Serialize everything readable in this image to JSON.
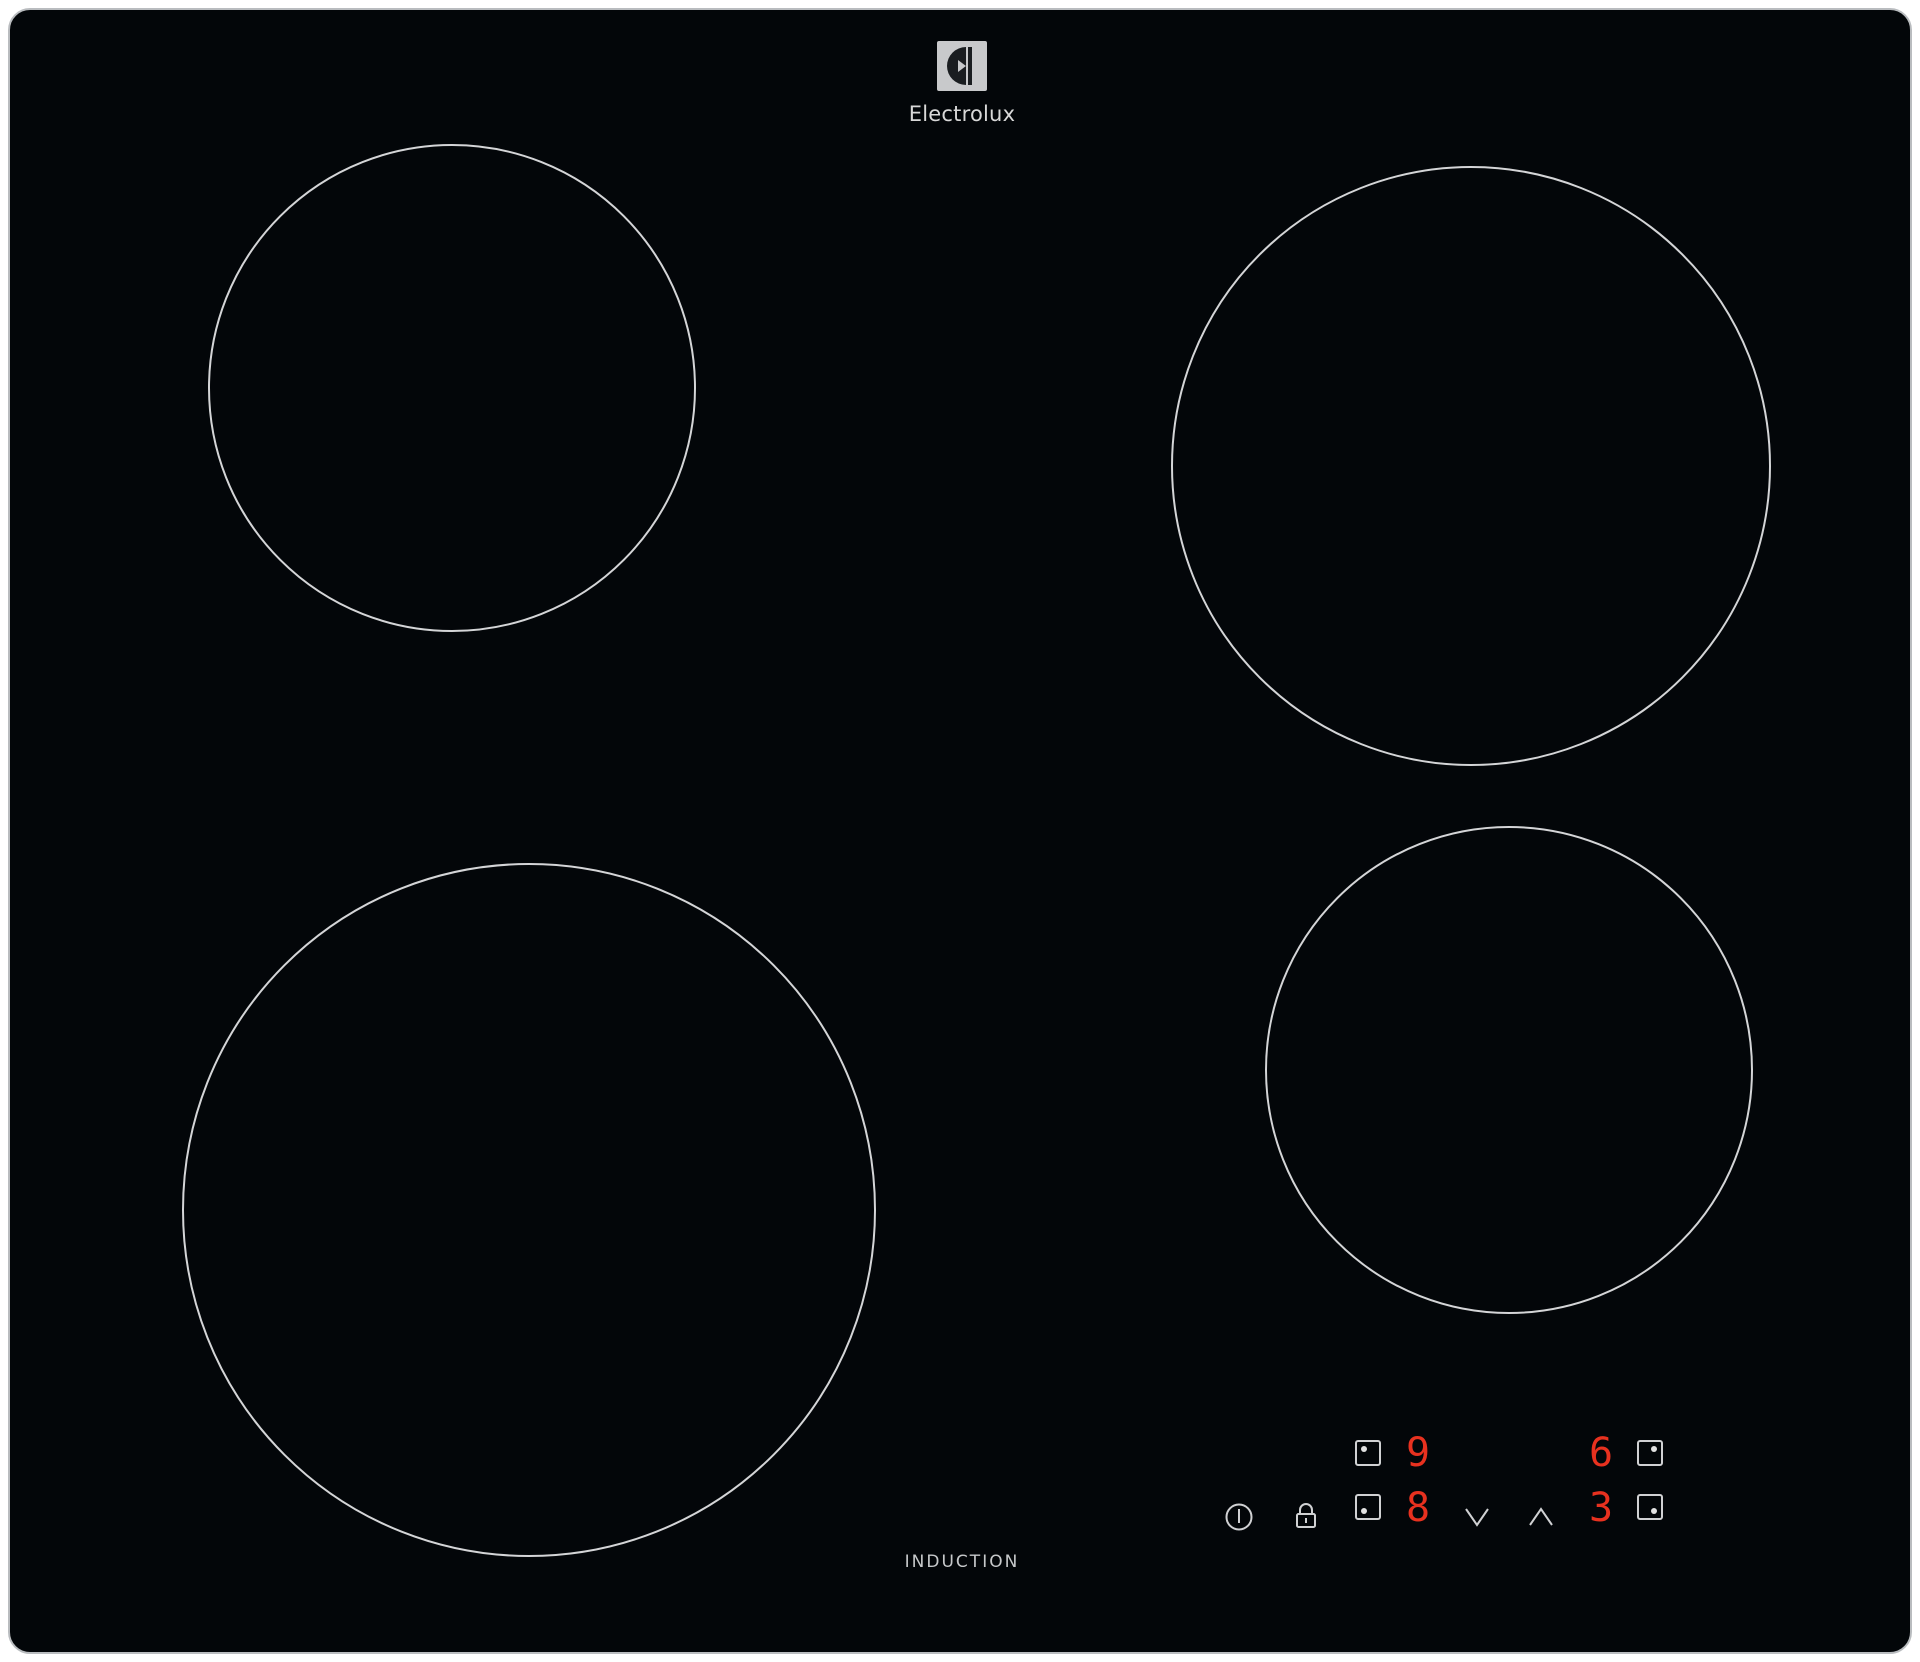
{
  "brand": {
    "name": "Electrolux",
    "logo_icon": "electrolux-logo-icon"
  },
  "cooktop": {
    "label": "INDUCTION",
    "surface_color": "#030609",
    "zone_outline_color": "#d4d5d7",
    "cooking_zones": 4
  },
  "controls": {
    "display_color": "#e8311f",
    "displays": {
      "rear_left": "9",
      "front_left": "8",
      "rear_right": "6",
      "front_right": "3"
    },
    "icons": {
      "power": "power-icon",
      "lock": "lock-icon",
      "minus": "chevron-down-icon",
      "plus": "chevron-up-icon"
    }
  }
}
